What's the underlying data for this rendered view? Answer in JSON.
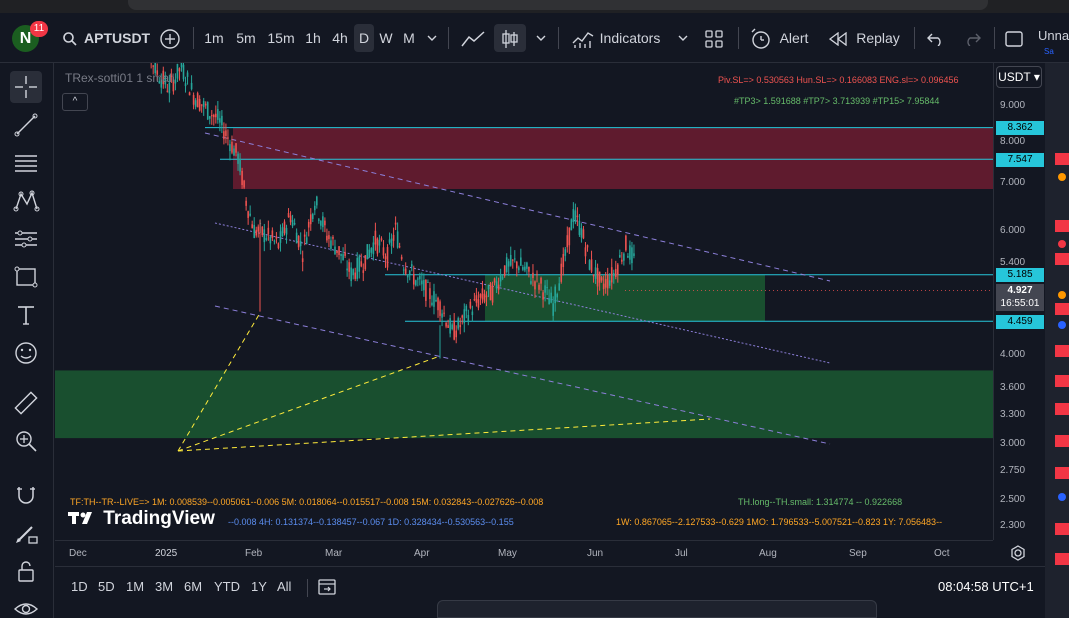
{
  "browser": {},
  "header": {
    "notification_count": "11",
    "avatar_letter": "N",
    "symbol": "APTUSDT",
    "timeframes": [
      "1m",
      "5m",
      "15m",
      "1h",
      "4h",
      "D",
      "W",
      "M"
    ],
    "active_timeframe": "D",
    "indicators_label": "Indicators",
    "alert_label": "Alert",
    "replay_label": "Replay",
    "layout_name": "Unna",
    "layout_sub": "Sa"
  },
  "legend": {
    "indicator_name": "TRex-sotti01 1 small",
    "collapse": "^"
  },
  "annotations": {
    "pivots": "Piv.SL=> 0.530563  Hun.SL=> 0.166083  ENG.sl=> 0.096456",
    "targets": "#TP3> 1.591688  #TP7> 3.713939  #TP15> 7.95844",
    "tf_line": "TF:TH--TR--LIVE=>  1M: 0.008539--0.005061--0.006   5M: 0.018064--0.015517--0.008   15M: 0.032843--0.027626--0.008",
    "th_line": "TH.long--TH.small: 1.314774 -- 0.922668",
    "tf_line2_a": "--0.008   4H: 0.131374--0.138457--0.067   1D: 0.328434--0.530563--0.155",
    "tf_line2_b": "1W: 0.867065--2.127533--0.629   1MO: 1.796533--5.007521--0.823   1Y: 7.056483--"
  },
  "logo_text": "TradingView",
  "price_axis": {
    "currency": "USDT",
    "ticks": [
      "9.000",
      "8.000",
      "7.000",
      "6.000",
      "5.400",
      "4.000",
      "3.600",
      "3.300",
      "3.000",
      "2.750",
      "2.500",
      "2.300"
    ],
    "labels": {
      "level_8362": "8.362",
      "level_7547": "7.547",
      "level_5185": "5.185",
      "current": "4.927",
      "countdown": "16:55:01",
      "level_4459": "4.459"
    }
  },
  "time_axis": {
    "labels": [
      "Dec",
      "2025",
      "Feb",
      "Mar",
      "Apr",
      "May",
      "Jun",
      "Jul",
      "Aug",
      "Sep",
      "Oct"
    ]
  },
  "bottom": {
    "ranges": [
      "1D",
      "5D",
      "1M",
      "3M",
      "6M",
      "YTD",
      "1Y",
      "All"
    ],
    "clock": "08:04:58 UTC+1"
  },
  "colors": {
    "bg": "#131722",
    "up": "#26a69a",
    "down": "#ef5350",
    "resistance_zone": "#7a1e33",
    "support_zone": "#1b5e33",
    "level_line": "#26c6da",
    "channel": "#8c7fd9",
    "yellow_lines": "#ffeb3b"
  },
  "chart_data": {
    "type": "candlestick",
    "symbol": "APTUSDT",
    "timeframe": "1D",
    "x_labels": [
      "Dec",
      "2025",
      "Feb",
      "Mar",
      "Apr",
      "May",
      "Jun",
      "Jul",
      "Aug",
      "Sep",
      "Oct"
    ],
    "y_scale": "log",
    "ylim": [
      2.2,
      10
    ],
    "horizontal_levels": [
      8.362,
      7.547,
      5.185,
      4.459
    ],
    "last_price": 4.927,
    "close_path": [
      [
        0,
        12.6
      ],
      [
        6,
        11.0
      ],
      [
        12,
        10.0
      ],
      [
        18,
        9.5
      ],
      [
        24,
        10.2
      ],
      [
        30,
        9.3
      ],
      [
        36,
        8.9
      ],
      [
        42,
        8.6
      ],
      [
        48,
        8.0
      ],
      [
        52,
        7.6
      ],
      [
        56,
        6.6
      ],
      [
        60,
        6.0
      ],
      [
        66,
        5.9
      ],
      [
        72,
        5.7
      ],
      [
        78,
        6.3
      ],
      [
        84,
        5.6
      ],
      [
        90,
        6.6
      ],
      [
        96,
        5.9
      ],
      [
        102,
        5.6
      ],
      [
        108,
        5.2
      ],
      [
        114,
        5.4
      ],
      [
        120,
        5.8
      ],
      [
        126,
        5.5
      ],
      [
        130,
        6.0
      ],
      [
        134,
        5.4
      ],
      [
        140,
        5.1
      ],
      [
        146,
        4.9
      ],
      [
        152,
        4.7
      ],
      [
        158,
        4.3
      ],
      [
        162,
        4.4
      ],
      [
        166,
        4.6
      ],
      [
        172,
        4.8
      ],
      [
        178,
        4.9
      ],
      [
        184,
        5.3
      ],
      [
        190,
        5.4
      ],
      [
        196,
        5.2
      ],
      [
        202,
        5.0
      ],
      [
        208,
        4.7
      ],
      [
        214,
        5.5
      ],
      [
        218,
        6.3
      ],
      [
        222,
        6.0
      ],
      [
        226,
        5.4
      ],
      [
        232,
        5.0
      ],
      [
        238,
        5.2
      ],
      [
        244,
        5.7
      ],
      [
        250,
        5.3
      ],
      [
        256,
        5.0
      ],
      [
        262,
        4.7
      ],
      [
        268,
        4.5
      ],
      [
        274,
        4.8
      ],
      [
        280,
        4.9
      ]
    ]
  }
}
